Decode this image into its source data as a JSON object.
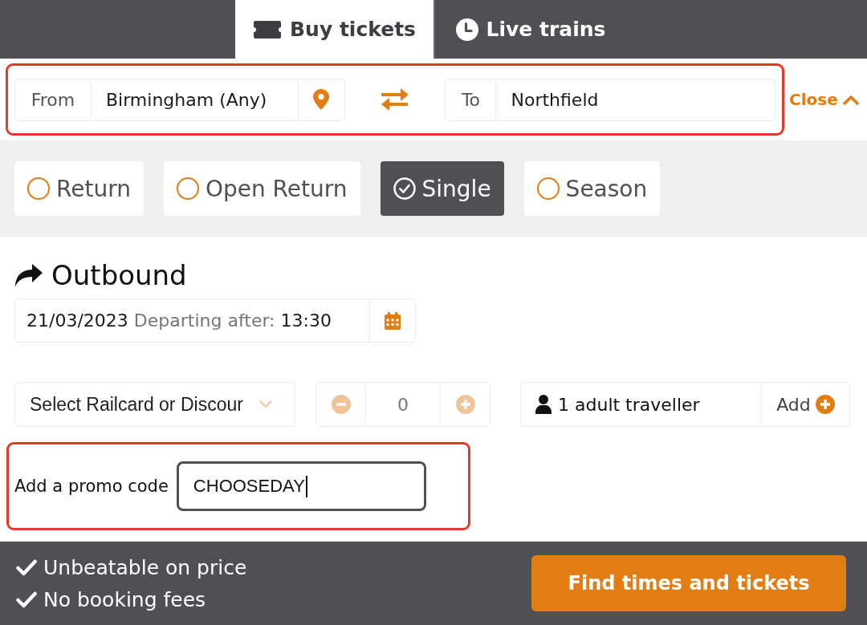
{
  "tabs": [
    {
      "label": "Buy tickets",
      "selected": true
    },
    {
      "label": "Live trains",
      "selected": false
    }
  ],
  "journey": {
    "from": {
      "label": "From",
      "value": "Birmingham (Any)"
    },
    "to": {
      "label": "To",
      "value": "Northfield"
    },
    "close_link": "Close"
  },
  "ticket_types": [
    {
      "label": "Return",
      "selected": false
    },
    {
      "label": "Open Return",
      "selected": false
    },
    {
      "label": "Single",
      "selected": true
    },
    {
      "label": "Season",
      "selected": false
    }
  ],
  "outbound": {
    "heading": "Outbound",
    "date": "21/03/2023",
    "time_label": "Departing after:",
    "time": "13:30"
  },
  "railcard": {
    "select": "Select Railcard or Discour",
    "count": "0",
    "count_disabled": true
  },
  "travellers": {
    "summary": "1 adult traveller",
    "add_button": "Add"
  },
  "promo_code": {
    "label": "Add a promo code",
    "value": "CHOOSEDAY",
    "focused": true
  },
  "footer": {
    "features": [
      "Unbeatable on price",
      "No booking fees"
    ],
    "submit_button": "Find times and tickets"
  }
}
